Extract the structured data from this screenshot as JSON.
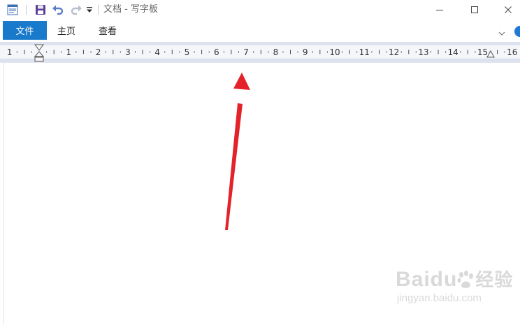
{
  "window": {
    "title": "文档 - 写字板",
    "controls": {
      "minimize": "minimize",
      "maximize": "maximize",
      "close": "close"
    }
  },
  "quick_access": [
    "app-icon",
    "save-icon",
    "undo-icon",
    "redo-icon",
    "customize-dropdown-icon"
  ],
  "menu": {
    "file_label": "文件",
    "tabs": [
      "主页",
      "查看"
    ]
  },
  "ruler": {
    "numbers": [
      "1",
      "1",
      "2",
      "3",
      "4",
      "5",
      "6",
      "7",
      "8",
      "9",
      "10",
      "11",
      "12",
      "13",
      "14",
      "15",
      "16"
    ]
  },
  "annotation": {
    "color": "#e3222a"
  },
  "watermark": {
    "brand": "Baidu",
    "brand_suffix": "经验",
    "url": "jingyan.baidu.com"
  }
}
